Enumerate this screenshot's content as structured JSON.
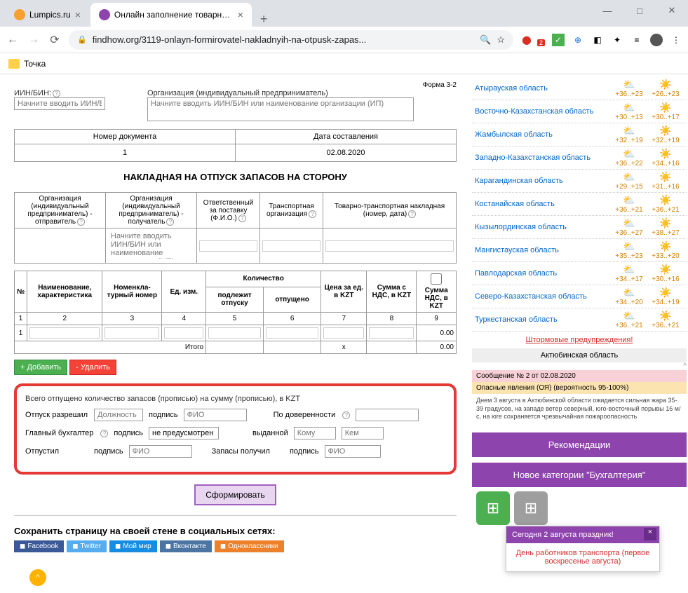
{
  "browser": {
    "tabs": [
      {
        "title": "Lumpics.ru"
      },
      {
        "title": "Онлайн заполнение товарной н"
      }
    ],
    "url": "findhow.org/3119-onlayn-formirovatel-nakladnyih-na-otpusk-zapas...",
    "bookmark": "Точка",
    "badge": "2"
  },
  "form": {
    "form_no": "Форма 3-2",
    "iin_label": "ИИН/БИН:",
    "iin_placeholder": "Начните вводить ИИН/Б",
    "org_label": "Организация (индивидуальный предприниматель)",
    "org_placeholder": "Начните вводить ИИН/БИН или наименование организации (ИП)",
    "doc_no_label": "Номер документа",
    "doc_no": "1",
    "date_label": "Дата составления",
    "date": "02.08.2020",
    "title": "НАКЛАДНАЯ НА ОТПУСК ЗАПАСОВ НА СТОРОНУ",
    "headers": {
      "sender": "Организация (индивидуальный предприниматель) - отправитель",
      "recipient": "Организация (индивидуальный предприниматель) - получатель",
      "responsible": "Ответственный за поставку (Ф.И.О.)",
      "transport_org": "Транспортная организация",
      "ttn": "Товарно-транспортная накладная (номер, дата)"
    },
    "recipient_placeholder": "Начните вводить ИИН/БИН или наименование организации (ИП)",
    "cols": {
      "n": "№",
      "name": "Наименование, характеристика",
      "nomen": "Номенкла-турный номер",
      "unit": "Ед. изм.",
      "qty": "Количество",
      "qty1": "подлежит отпуску",
      "qty2": "отпущено",
      "price": "Цена за ед. в KZT",
      "sum": "Сумма с НДС, в KZT",
      "nds": "Сумма НДС, в KZT"
    },
    "nums": [
      "1",
      "2",
      "3",
      "4",
      "5",
      "6",
      "7",
      "8",
      "9"
    ],
    "row1": "1",
    "total": "Итого",
    "x": "x",
    "zero": "0.00",
    "add": "+ Добавить",
    "del": "- Удалить",
    "released_label": "Всего отпущено количество запасов (прописью) на сумму (прописью), в KZT",
    "allow": "Отпуск разрешил",
    "position": "Должность",
    "sign": "подпись",
    "fio": "ФИО",
    "by_proxy": "По доверенности",
    "accountant": "Главный бухгалтер",
    "not_provided": "не предусмотрен",
    "issued": "выданной",
    "whom": "Кому",
    "by": "Кем",
    "released": "Отпустил",
    "received": "Запасы получил",
    "submit": "Сформировать",
    "share": "Сохранить страницу на своей стене в социальных сетях:",
    "social": {
      "fb": "Facebook",
      "tw": "Twitter",
      "mm": "Мой мир",
      "vk": "Вконтакте",
      "ok": "Одноклассники"
    }
  },
  "weather": {
    "regions": [
      {
        "name": "Атырауская область",
        "d": "+36..+23",
        "n": "+26..+23"
      },
      {
        "name": "Восточно-Казахстанская область",
        "d": "+30..+13",
        "n": "+30..+17"
      },
      {
        "name": "Жамбылская область",
        "d": "+32..+19",
        "n": "+32..+19"
      },
      {
        "name": "Западно-Казахстанская область",
        "d": "+36..+22",
        "n": "+34..+16"
      },
      {
        "name": "Карагандинская область",
        "d": "+29..+15",
        "n": "+31..+16"
      },
      {
        "name": "Костанайская область",
        "d": "+36..+21",
        "n": "+36..+21"
      },
      {
        "name": "Кызылординская область",
        "d": "+36..+27",
        "n": "+38..+27"
      },
      {
        "name": "Мангистауская область",
        "d": "+35..+23",
        "n": "+33..+20"
      },
      {
        "name": "Павлодарская область",
        "d": "+34..+17",
        "n": "+30..+16"
      },
      {
        "name": "Северо-Казахстанская область",
        "d": "+34..+20",
        "n": "+34..+19"
      },
      {
        "name": "Туркестанская область",
        "d": "+36..+21",
        "n": "+36..+21"
      }
    ],
    "storm": "Штормовые предупреждения!",
    "region_title": "Актюбинская область",
    "msg": "Сообщение № 2 от 02.08.2020",
    "warn": "Опасные явления (ОЯ) (вероятность 95-100%)",
    "forecast": "Днем 3 августа в Актюбинской области ожидается сильная жара 35-39 градусов, на западе ветер северный, юго-восточный порывы 16 м/с, на юге сохраняется чрезвычайная пожароопасность"
  },
  "sidebar": {
    "recommend": "Рекомендации",
    "new_cat": "Новое категории \"Бухгалтерия\""
  },
  "notif": {
    "head": "Сегодня 2 августа праздник!",
    "line1": "День работников транспорта (первое воскресенье августа)"
  }
}
